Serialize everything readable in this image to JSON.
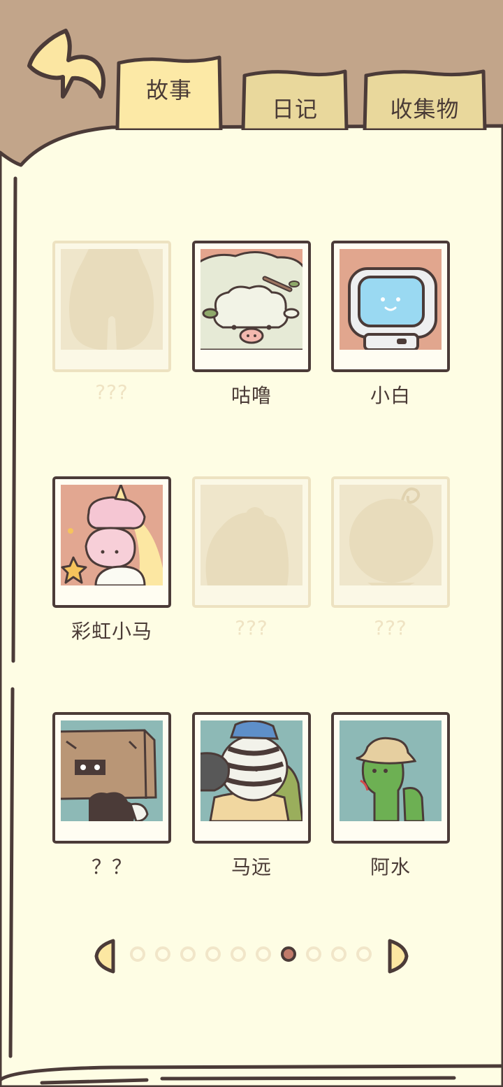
{
  "tabs": {
    "story": "故事",
    "diary": "日记",
    "collection": "收集物"
  },
  "active_tab": "story",
  "characters": [
    {
      "name": "???",
      "locked": true
    },
    {
      "name": "咕噜",
      "locked": false
    },
    {
      "name": "小白",
      "locked": false
    },
    {
      "name": "彩虹小马",
      "locked": false
    },
    {
      "name": "???",
      "locked": true
    },
    {
      "name": "???",
      "locked": true
    },
    {
      "name": "？？",
      "locked": false
    },
    {
      "name": "马远",
      "locked": false
    },
    {
      "name": "阿水",
      "locked": false
    }
  ],
  "pagination": {
    "total_pages": 10,
    "current_page": 7
  },
  "colors": {
    "header_bg": "#C2A58A",
    "page_bg": "#FEFDE4",
    "tab_fill": "#FBE8A6",
    "outline": "#4B3B38",
    "active_dot": "#C07A6A"
  }
}
